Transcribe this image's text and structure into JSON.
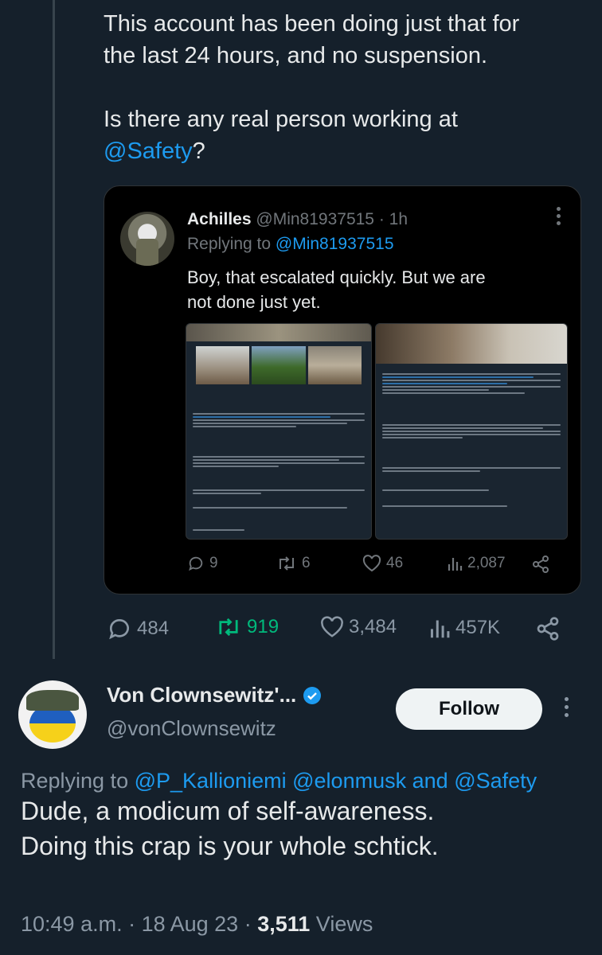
{
  "parent_tweet": {
    "line1": "This account has been doing just that for",
    "line2": "the last 24 hours, and no suspension.",
    "line3": "Is there any real person working at",
    "mention": "@Safety",
    "trail": "?"
  },
  "quoted_tweet": {
    "name": "Achilles",
    "handle": "@Min81937515",
    "time": "· 1h",
    "replying_label": "Replying to",
    "replying_to": "@Min81937515",
    "text_line1": "Boy, that escalated quickly. But we are",
    "text_line2": "not done just yet.",
    "replies": "9",
    "retweets": "6",
    "likes": "46",
    "views": "2,087"
  },
  "parent_actions": {
    "replies": "484",
    "retweets": "919",
    "likes": "3,484",
    "views": "457K"
  },
  "reply_tweet": {
    "name": "Von Clownsewitz'...",
    "handle": "@vonClownsewitz",
    "follow_label": "Follow",
    "replying_label": "Replying to",
    "replying_to_1": "@P_Kallioniemi",
    "replying_to_2": "@elonmusk",
    "and_label": "and",
    "replying_to_3": "@Safety",
    "text_line1": "Dude, a modicum of self-awareness.",
    "text_line2": "Doing this crap is your whole schtick.",
    "timestamp": "10:49 a.m. · 18 Aug 23 ·",
    "views_count": "3,511",
    "views_label": "Views"
  },
  "colors": {
    "background": "#15202b",
    "accent": "#1d9bf0",
    "retweet": "#00ba7c",
    "muted": "#8b98a5"
  }
}
